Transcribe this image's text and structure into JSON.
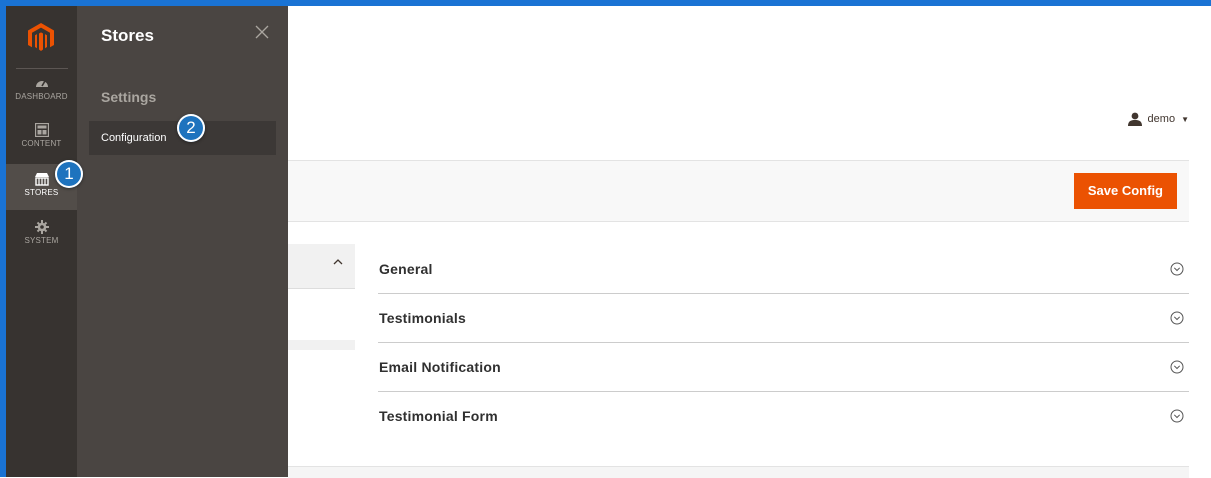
{
  "header": {
    "username": "demo"
  },
  "toolbar": {
    "save_label": "Save Config"
  },
  "sections": [
    {
      "title": "General"
    },
    {
      "title": "Testimonials"
    },
    {
      "title": "Email Notification"
    },
    {
      "title": "Testimonial Form"
    }
  ],
  "rail": {
    "items": [
      {
        "label": "DASHBOARD",
        "icon": "dashboard-icon"
      },
      {
        "label": "CONTENT",
        "icon": "content-icon"
      },
      {
        "label": "STORES",
        "icon": "stores-icon"
      },
      {
        "label": "SYSTEM",
        "icon": "gear-icon"
      }
    ]
  },
  "flyout": {
    "title": "Stores",
    "group": "Settings",
    "item": "Configuration"
  },
  "badges": {
    "one": "1",
    "two": "2"
  },
  "colors": {
    "accent": "#eb5202",
    "rail": "#373330",
    "flyout": "#4a4542",
    "badge": "#1e73be"
  }
}
